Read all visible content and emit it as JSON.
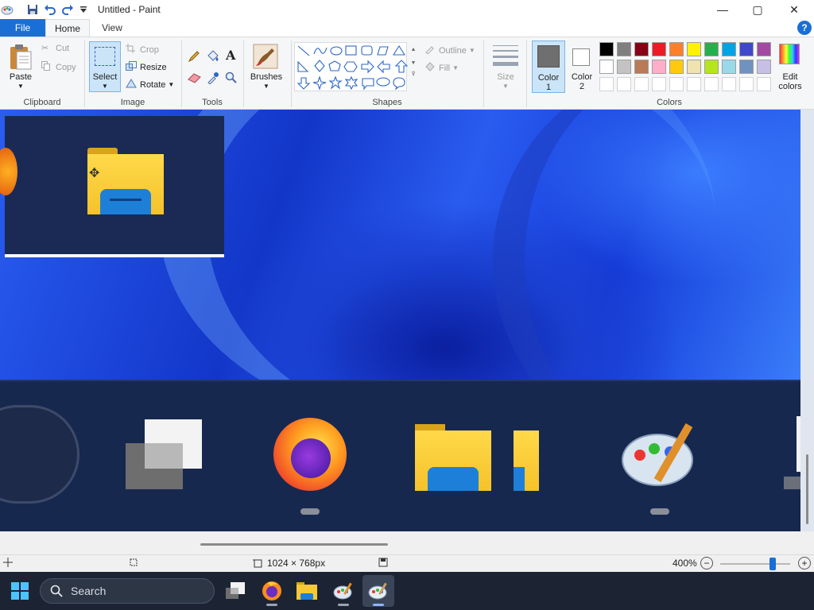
{
  "app": {
    "title": "Untitled - Paint"
  },
  "window_controls": {
    "minimize": "—",
    "maximize": "▢",
    "close": "✕"
  },
  "tabs": [
    {
      "label": "File"
    },
    {
      "label": "Home"
    },
    {
      "label": "View"
    }
  ],
  "ribbon": {
    "clipboard": {
      "group_label": "Clipboard",
      "paste": "Paste",
      "cut": "Cut",
      "copy": "Copy"
    },
    "image": {
      "group_label": "Image",
      "select": "Select",
      "crop": "Crop",
      "resize": "Resize",
      "rotate": "Rotate"
    },
    "tools": {
      "group_label": "Tools"
    },
    "brushes": {
      "label": "Brushes"
    },
    "shapes": {
      "group_label": "Shapes",
      "outline": "Outline",
      "fill": "Fill"
    },
    "size": {
      "label": "Size"
    },
    "color1": {
      "line1": "Color",
      "line2": "1",
      "value": "#6f6f6f"
    },
    "color2": {
      "line1": "Color",
      "line2": "2",
      "value": "#ffffff"
    },
    "colors": {
      "group_label": "Colors",
      "row1": [
        "#000000",
        "#7f7f7f",
        "#880015",
        "#ed1c24",
        "#ff7f27",
        "#fff200",
        "#22b14c",
        "#00a2e8",
        "#3f48cc",
        "#a349a4"
      ],
      "row2": [
        "#ffffff",
        "#c3c3c3",
        "#b97a57",
        "#ffaec9",
        "#ffc90e",
        "#efe4b0",
        "#b5e61d",
        "#99d9ea",
        "#7092be",
        "#c8bfe7"
      ]
    },
    "edit_colors": {
      "line1": "Edit",
      "line2": "colors"
    },
    "help_icon": "?"
  },
  "statusbar": {
    "dimensions": "1024 × 768px",
    "zoom": "400%",
    "zoom_level": 0.75
  },
  "taskbar": {
    "search_label": "Search"
  }
}
